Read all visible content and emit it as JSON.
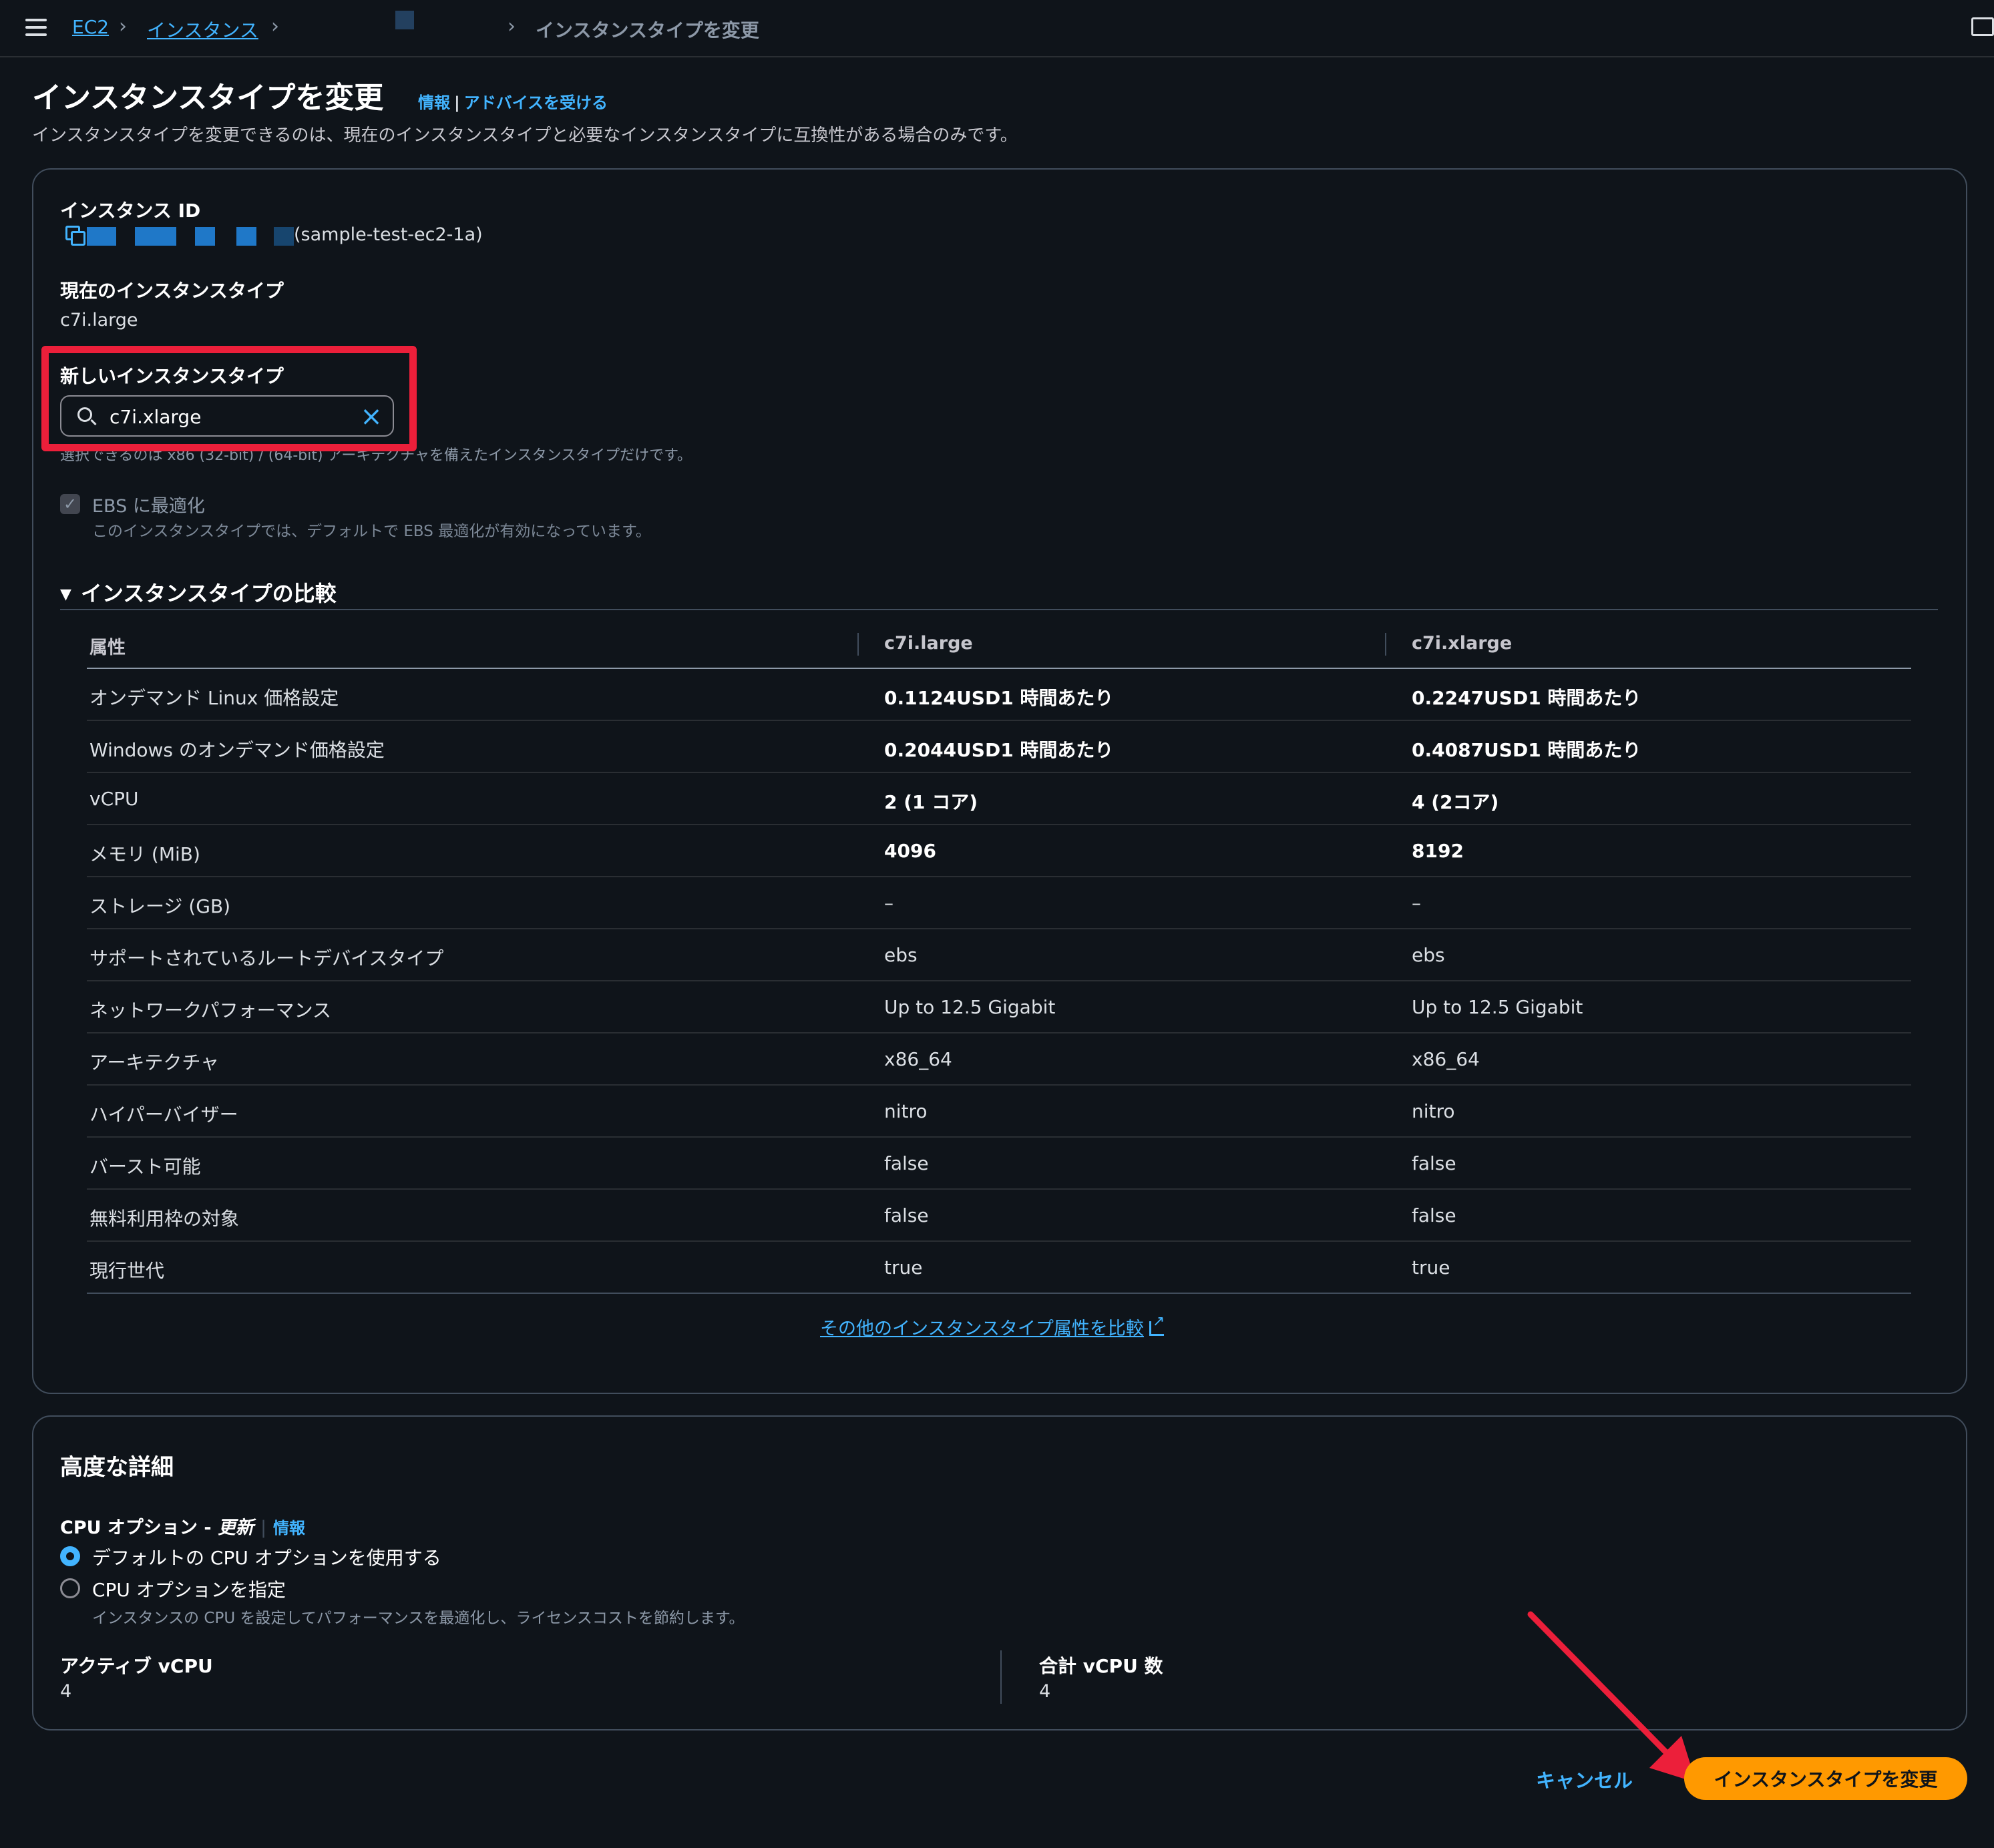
{
  "breadcrumb": {
    "ec2": "EC2",
    "instances": "インスタンス",
    "current": "インスタンスタイプを変更"
  },
  "header": {
    "title": "インスタンスタイプを変更",
    "info_link": "情報",
    "separator": "|",
    "advice_link": "アドバイスを受ける",
    "description": "インスタンスタイプを変更できるのは、現在のインスタンスタイプと必要なインスタンスタイプに互換性がある場合のみです。"
  },
  "instance": {
    "id_label": "インスタンス ID",
    "id_name": "(sample-test-ec2-1a)",
    "current_type_label": "現在のインスタンスタイプ",
    "current_type": "c7i.large",
    "new_type_label": "新しいインスタンスタイプ",
    "new_type_value": "c7i.xlarge",
    "new_type_hint": "選択できるのは x86 (32-bit) / (64-bit) アーキテクチャを備えたインスタンスタイプだけです。",
    "ebs_label": "EBS に最適化",
    "ebs_desc": "このインスタンスタイプでは、デフォルトで EBS 最適化が有効になっています。",
    "ebs_checked": true
  },
  "comparison": {
    "title": "インスタンスタイプの比較",
    "headers": [
      "属性",
      "c7i.large",
      "c7i.xlarge"
    ],
    "rows": [
      {
        "attr": "オンデマンド Linux 価格設定",
        "a": "0.1124USD1 時間あたり",
        "b": "0.2247USD1 時間あたり"
      },
      {
        "attr": "Windows のオンデマンド価格設定",
        "a": "0.2044USD1 時間あたり",
        "b": "0.4087USD1 時間あたり"
      },
      {
        "attr": "vCPU",
        "a": "2 (1 コア)",
        "b": "4 (2コア)"
      },
      {
        "attr": "メモリ (MiB)",
        "a": "4096",
        "b": "8192"
      },
      {
        "attr": "ストレージ (GB)",
        "a": "–",
        "b": "–"
      },
      {
        "attr": "サポートされているルートデバイスタイプ",
        "a": "ebs",
        "b": "ebs"
      },
      {
        "attr": "ネットワークパフォーマンス",
        "a": "Up to 12.5 Gigabit",
        "b": "Up to 12.5 Gigabit"
      },
      {
        "attr": "アーキテクチャ",
        "a": "x86_64",
        "b": "x86_64"
      },
      {
        "attr": "ハイパーバイザー",
        "a": "nitro",
        "b": "nitro"
      },
      {
        "attr": "バースト可能",
        "a": "false",
        "b": "false"
      },
      {
        "attr": "無料利用枠の対象",
        "a": "false",
        "b": "false"
      },
      {
        "attr": "現行世代",
        "a": "true",
        "b": "true"
      }
    ],
    "compare_link": "その他のインスタンスタイプ属性を比較"
  },
  "advanced": {
    "title": "高度な詳細",
    "cpu_options_label": "CPU オプション - ",
    "cpu_options_italic": "更新",
    "info_link": "情報",
    "radio_default": "デフォルトの CPU オプションを使用する",
    "radio_specify": "CPU オプションを指定",
    "radio_specify_desc": "インスタンスの CPU を設定してパフォーマンスを最適化し、ライセンスコストを節約します。",
    "selected": "default",
    "active_vcpu_label": "アクティブ vCPU",
    "active_vcpu_value": "4",
    "total_vcpu_label": "合計 vCPU 数",
    "total_vcpu_value": "4"
  },
  "footer": {
    "cancel": "キャンセル",
    "submit": "インスタンスタイプを変更"
  },
  "colors": {
    "background": "#0f141a",
    "link": "#42b4ff",
    "primary_button": "#ff9900",
    "highlight": "#ec1f3a"
  }
}
